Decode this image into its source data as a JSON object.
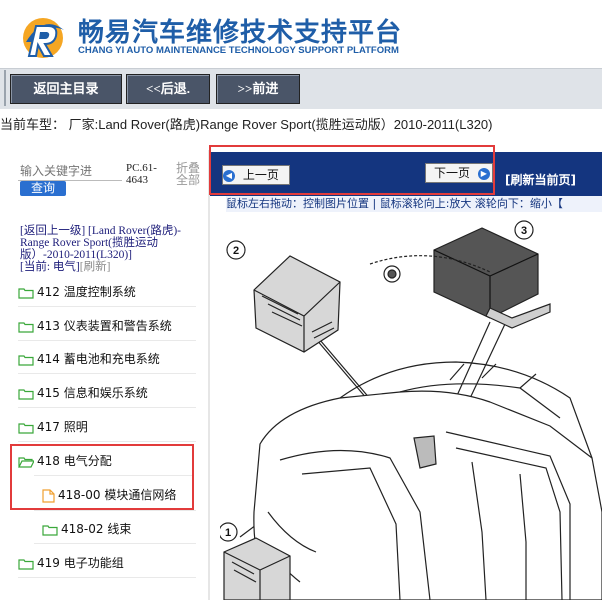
{
  "header": {
    "brand_cn": "畅易汽车维修技术支持平台",
    "brand_en": "CHANG YI AUTO MAINTENANCE TECHNOLOGY SUPPORT PLATFORM",
    "brand_color": "#1f5ea8"
  },
  "toolbar": {
    "home_label": "返回主目录",
    "back_label": "<<后退.",
    "forward_label": ">>前进"
  },
  "vehicle": {
    "line": "当前车型：  厂家:Land Rover(路虎)Range Rover Sport(揽胜运动版）2010-2011(L320)"
  },
  "sidebar": {
    "search_placeholder": "输入关键字进",
    "search_button": "查询",
    "pc_code": "PC.61-4643",
    "collapse_all": "折叠全部",
    "breadcrumb_up": "[返回上一级]",
    "breadcrumb_path": "[Land Rover(路虎)-Range Rover Sport(揽胜运动版）-2010-2011(L320)]",
    "breadcrumb_current": "[当前: 电气]",
    "breadcrumb_refresh": "[刷新]",
    "items": [
      {
        "label": "412 温度控制系统"
      },
      {
        "label": "413 仪表装置和警告系统"
      },
      {
        "label": "414 蓄电池和充电系统"
      },
      {
        "label": "415 信息和娱乐系统"
      },
      {
        "label": "417 照明"
      },
      {
        "label": "418 电气分配"
      },
      {
        "label": "418-00 模块通信网络"
      },
      {
        "label": "418-02 线束"
      },
      {
        "label": "419 电子功能组"
      }
    ]
  },
  "content": {
    "prev_label": "上一页",
    "next_label": "下一页",
    "refresh_label": "[刷新当前页]",
    "help_text": "鼠标左右拖动：控制图片位置 | 鼠标滚轮向上:放大  滚轮向下：缩小【",
    "callouts": [
      "1",
      "2",
      "3"
    ],
    "bar_color": "#14357f",
    "highlight_color": "#e23b3b"
  }
}
